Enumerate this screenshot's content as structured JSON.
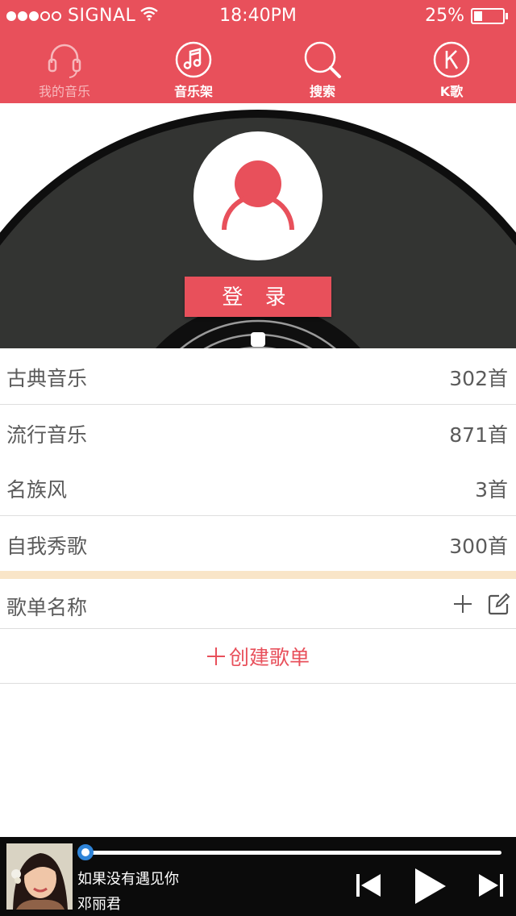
{
  "status_bar": {
    "carrier": "SIGNAL",
    "time": "18:40PM",
    "battery": "25%",
    "battery_level": 0.25,
    "signal_bars_filled": 3,
    "signal_bars_total": 5
  },
  "nav": {
    "tabs": [
      {
        "label": "我的音乐",
        "icon": "headphones-icon",
        "active": true
      },
      {
        "label": "音乐架",
        "icon": "music-note-icon",
        "active": false
      },
      {
        "label": "搜索",
        "icon": "search-icon",
        "active": false
      },
      {
        "label": "K歌",
        "icon": "k-icon",
        "active": false
      }
    ]
  },
  "login": {
    "button_label": "登 录"
  },
  "categories": [
    {
      "name": "古典音乐",
      "count": "302首"
    },
    {
      "name": "流行音乐",
      "count": "871首"
    },
    {
      "name": "名族风",
      "count": "3首"
    },
    {
      "name": "自我秀歌",
      "count": "300首"
    }
  ],
  "playlists": {
    "header_label": "歌单名称",
    "create_label": "创建歌单"
  },
  "player": {
    "title": "如果没有遇见你",
    "artist": "邓丽君",
    "progress": 0.0
  },
  "colors": {
    "accent": "#e8505b",
    "accent_dark": "#cf1f2e",
    "separator": "#f9e5c8",
    "player_bg": "#0b0b0b",
    "progress_thumb": "#2f84d8"
  }
}
